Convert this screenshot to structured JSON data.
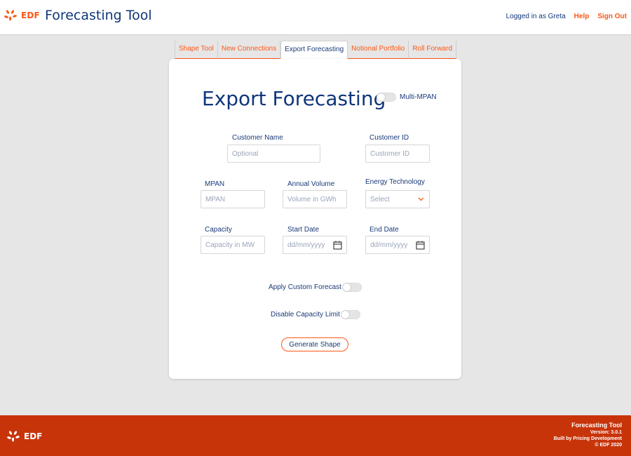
{
  "header": {
    "logo_text": "EDF",
    "title": "Forecasting Tool",
    "logged_in": "Logged in as Greta",
    "help": "Help",
    "sign_out": "Sign Out"
  },
  "tabs": [
    {
      "label": "Shape Tool",
      "active": false
    },
    {
      "label": "New Connections",
      "active": false
    },
    {
      "label": "Export Forecasting",
      "active": true
    },
    {
      "label": "Notional Portfolio",
      "active": false
    },
    {
      "label": "Roll Forward",
      "active": false
    }
  ],
  "form": {
    "title": "Export Forecasting",
    "multi_mpan_label": "Multi-MPAN",
    "customer_name": {
      "label": "Customer Name",
      "placeholder": "Optional"
    },
    "customer_id": {
      "label": "Customer ID",
      "placeholder": "Customer ID"
    },
    "mpan": {
      "label": "MPAN",
      "placeholder": "MPAN"
    },
    "annual_volume": {
      "label": "Annual Volume",
      "placeholder": "Volume in GWh"
    },
    "energy_technology": {
      "label": "Energy Technology",
      "value": "Select"
    },
    "capacity": {
      "label": "Capacity",
      "placeholder": "Capacity in MW"
    },
    "start_date": {
      "label": "Start Date",
      "value": "dd/mm/yyyy"
    },
    "end_date": {
      "label": "End Date",
      "value": "dd/mm/yyyy"
    },
    "apply_custom_forecast": "Apply Custom Forecast",
    "disable_capacity_limit": "Disable Capacity Limit",
    "generate_button": "Generate Shape"
  },
  "footer": {
    "logo_text": "EDF",
    "app_name": "Forecasting Tool",
    "version": "Version: 3.0.1",
    "built_by": "Built by Pricing Development",
    "copyright": "© EDF 2020"
  },
  "colors": {
    "brand_orange": "#fe5716",
    "brand_navy": "#10367a",
    "footer_red": "#c8340a"
  }
}
